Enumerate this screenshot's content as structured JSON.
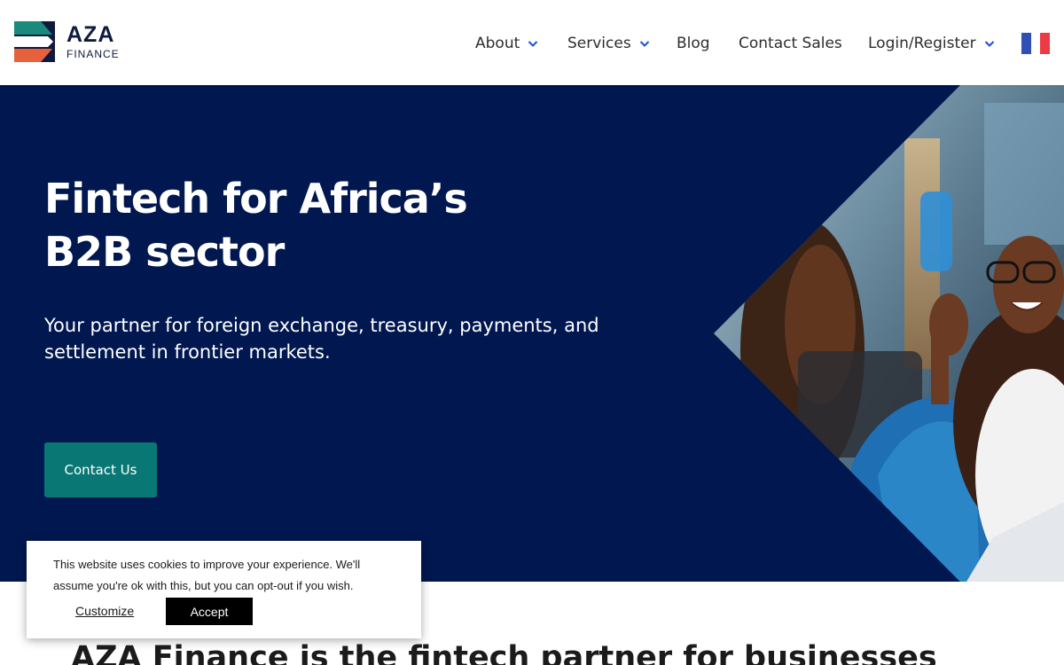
{
  "header": {
    "logo": {
      "main": "AZA",
      "sub": "FINANCE"
    },
    "nav": [
      {
        "label": "About",
        "has_dropdown": true
      },
      {
        "label": "Services",
        "has_dropdown": true
      },
      {
        "label": "Blog",
        "has_dropdown": false
      },
      {
        "label": "Contact Sales",
        "has_dropdown": false
      },
      {
        "label": "Login/Register",
        "has_dropdown": true
      }
    ],
    "language_flag": "french-flag-icon"
  },
  "hero": {
    "title_line1": "Fintech for Africa’s",
    "title_line2": "B2B sector",
    "subtitle": "Your partner for foreign exchange, treasury, payments, and settlement in frontier markets.",
    "cta_label": "Contact Us"
  },
  "section": {
    "title": "AZA Finance is the fintech partner for businesses"
  },
  "cookie_banner": {
    "text": "This website uses cookies to improve your experience. We'll assume you're ok with this, but you can opt-out if you wish.",
    "customize_label": "Customize",
    "accept_label": "Accept"
  },
  "colors": {
    "hero_bg": "#00174f",
    "cta_bg": "#097774",
    "nav_chevron": "#1d4ed8",
    "logo_red": "#e8613d",
    "logo_teal": "#1a8a7d",
    "logo_navy": "#0f1a3d"
  }
}
